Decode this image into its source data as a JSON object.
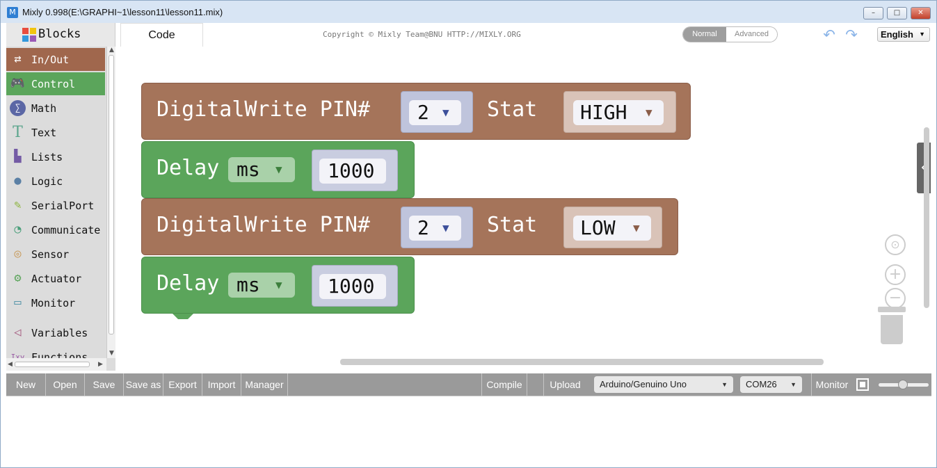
{
  "window": {
    "title": "Mixly 0.998(E:\\GRAPHI~1\\lesson11\\lesson11.mix)",
    "minimize": "–",
    "maximize": "□",
    "close": "✕"
  },
  "header": {
    "blocks_tab": "Blocks",
    "code_tab": "Code",
    "copyright": "Copyright © Mixly Team@BNU HTTP://MIXLY.ORG",
    "mode_normal": "Normal",
    "mode_advanced": "Advanced",
    "language": "English"
  },
  "toolbox": {
    "categories": [
      {
        "label": "In/Out",
        "icon": "in-out-icon"
      },
      {
        "label": "Control",
        "icon": "gamepad-icon"
      },
      {
        "label": "Math",
        "icon": "math-icon"
      },
      {
        "label": "Text",
        "icon": "text-icon"
      },
      {
        "label": "Lists",
        "icon": "lists-icon"
      },
      {
        "label": "Logic",
        "icon": "bulb-icon"
      },
      {
        "label": "SerialPort",
        "icon": "serial-icon"
      },
      {
        "label": "Communicate",
        "icon": "satellite-icon"
      },
      {
        "label": "Sensor",
        "icon": "sensor-icon"
      },
      {
        "label": "Actuator",
        "icon": "actuator-icon"
      },
      {
        "label": "Monitor",
        "icon": "monitor-icon"
      },
      {
        "label": "Variables",
        "icon": "variables-icon"
      },
      {
        "label": "Functions",
        "icon": "functions-icon"
      }
    ]
  },
  "blocks": {
    "digitalwrite_1": {
      "label": "DigitalWrite PIN#",
      "pin": "2",
      "stat_label": "Stat",
      "stat": "HIGH"
    },
    "delay_1": {
      "label": "Delay",
      "unit": "ms",
      "value": "1000"
    },
    "digitalwrite_2": {
      "label": "DigitalWrite PIN#",
      "pin": "2",
      "stat_label": "Stat",
      "stat": "LOW"
    },
    "delay_2": {
      "label": "Delay",
      "unit": "ms",
      "value": "1000"
    },
    "dropdown_caret": "▼"
  },
  "bottombar": {
    "new": "New",
    "open": "Open",
    "save": "Save",
    "save_as": "Save as",
    "export": "Export",
    "import": "Import",
    "manager": "Manager",
    "compile": "Compile",
    "upload": "Upload",
    "board": "Arduino/Genuino Uno",
    "port": "COM26",
    "monitor": "Monitor"
  },
  "colors": {
    "inout_brown": "#a5745a",
    "control_green": "#5ba55b"
  }
}
